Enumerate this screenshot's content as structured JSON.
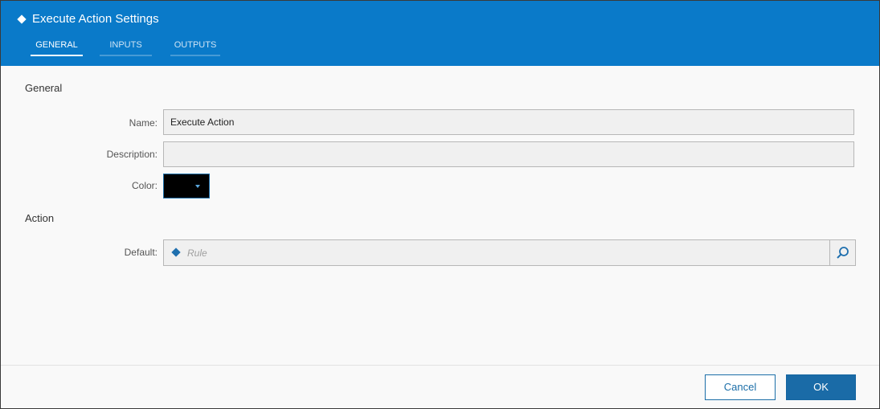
{
  "dialog": {
    "title": "Execute Action Settings",
    "tabs": [
      {
        "label": "GENERAL",
        "active": true
      },
      {
        "label": "INPUTS",
        "active": false
      },
      {
        "label": "OUTPUTS",
        "active": false
      }
    ]
  },
  "general": {
    "section_title": "General",
    "name_label": "Name:",
    "name_value": "Execute Action",
    "description_label": "Description:",
    "description_value": "",
    "color_label": "Color:",
    "color_value": "#000000"
  },
  "action": {
    "section_title": "Action",
    "default_label": "Default:",
    "default_placeholder": "Rule",
    "default_icon": "diamond-icon",
    "search_icon": "search-icon"
  },
  "footer": {
    "cancel_label": "Cancel",
    "ok_label": "OK"
  },
  "colors": {
    "header_bg": "#0a7ac9",
    "accent": "#1a6ba7"
  }
}
